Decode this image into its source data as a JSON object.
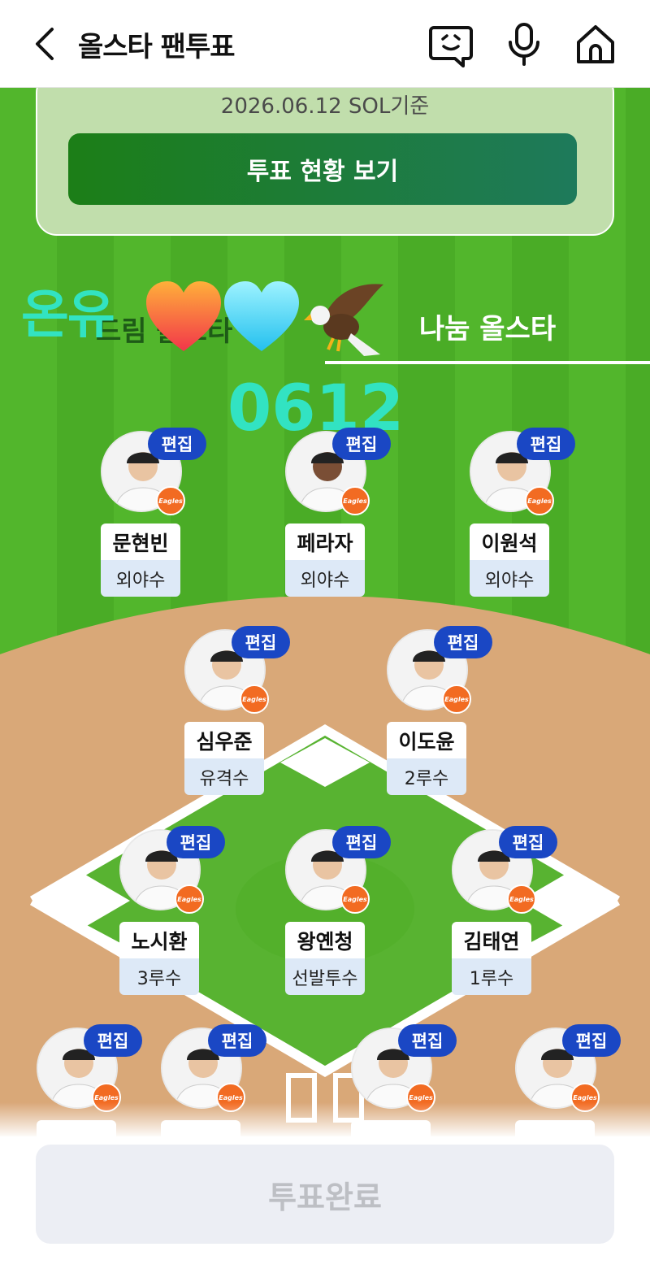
{
  "header": {
    "title": "올스타 팬투표"
  },
  "card": {
    "date": "2026.06.12 SOL기준",
    "button_label": "투표 현황 보기"
  },
  "tabs": {
    "left_label": "드림 올스타",
    "right_label": "나눔 올스타"
  },
  "overlay": {
    "name": "온유",
    "number": "0612"
  },
  "edit_label": "편집",
  "players": [
    {
      "name": "문현빈",
      "position": "외야수"
    },
    {
      "name": "페라자",
      "position": "외야수"
    },
    {
      "name": "이원석",
      "position": "외야수"
    },
    {
      "name": "심우준",
      "position": "유격수"
    },
    {
      "name": "이도윤",
      "position": "2루수"
    },
    {
      "name": "노시환",
      "position": "3루수"
    },
    {
      "name": "왕옌청",
      "position": "선발투수"
    },
    {
      "name": "김태연",
      "position": "1루수"
    },
    {
      "name": "",
      "position": ""
    },
    {
      "name": "",
      "position": ""
    },
    {
      "name": "",
      "position": ""
    },
    {
      "name": "",
      "position": ""
    }
  ],
  "team_logo_text": "Eagles",
  "footer": {
    "button_label": "투표완료"
  },
  "colors": {
    "edit_badge": "#1a47c4",
    "primary_button": "#1c7e17",
    "overlay_text": "#32e3c2",
    "infield": "#d9a878"
  }
}
